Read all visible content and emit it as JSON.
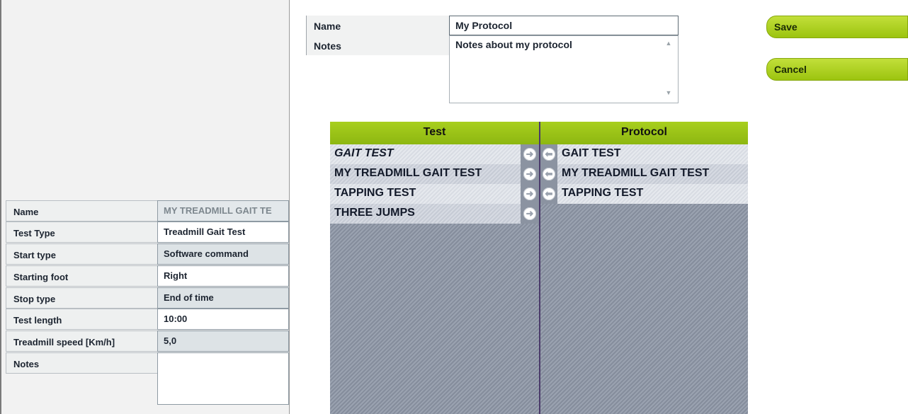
{
  "left_panel": {
    "properties": [
      {
        "label": "Name",
        "value": "MY TREADMILL GAIT TE"
      },
      {
        "label": "Test Type",
        "value": "Treadmill Gait Test"
      },
      {
        "label": "Start type",
        "value": "Software command"
      },
      {
        "label": "Starting foot",
        "value": "Right"
      },
      {
        "label": "Stop type",
        "value": "End of time"
      },
      {
        "label": "Test length",
        "value": "10:00"
      },
      {
        "label": "Treadmill speed [Km/h]",
        "value": "5,0"
      },
      {
        "label": "Notes",
        "value": ""
      }
    ]
  },
  "protocol_form": {
    "name_label": "Name",
    "name_value": "My Protocol",
    "notes_label": "Notes",
    "notes_value": "Notes about my protocol"
  },
  "actions": {
    "save_label": "Save",
    "cancel_label": "Cancel"
  },
  "test_list": {
    "header": "Test",
    "items": [
      "GAIT TEST",
      "MY TREADMILL GAIT TEST",
      "TAPPING TEST",
      "THREE JUMPS"
    ]
  },
  "protocol_list": {
    "header": "Protocol",
    "items": [
      "GAIT TEST",
      "MY TREADMILL GAIT TEST",
      "TAPPING TEST"
    ]
  },
  "icons": {
    "add": "arrow-right-icon",
    "remove": "arrow-left-icon"
  },
  "colors": {
    "accent_green": "#a8cf1e",
    "list_background": "#8e96a5"
  }
}
